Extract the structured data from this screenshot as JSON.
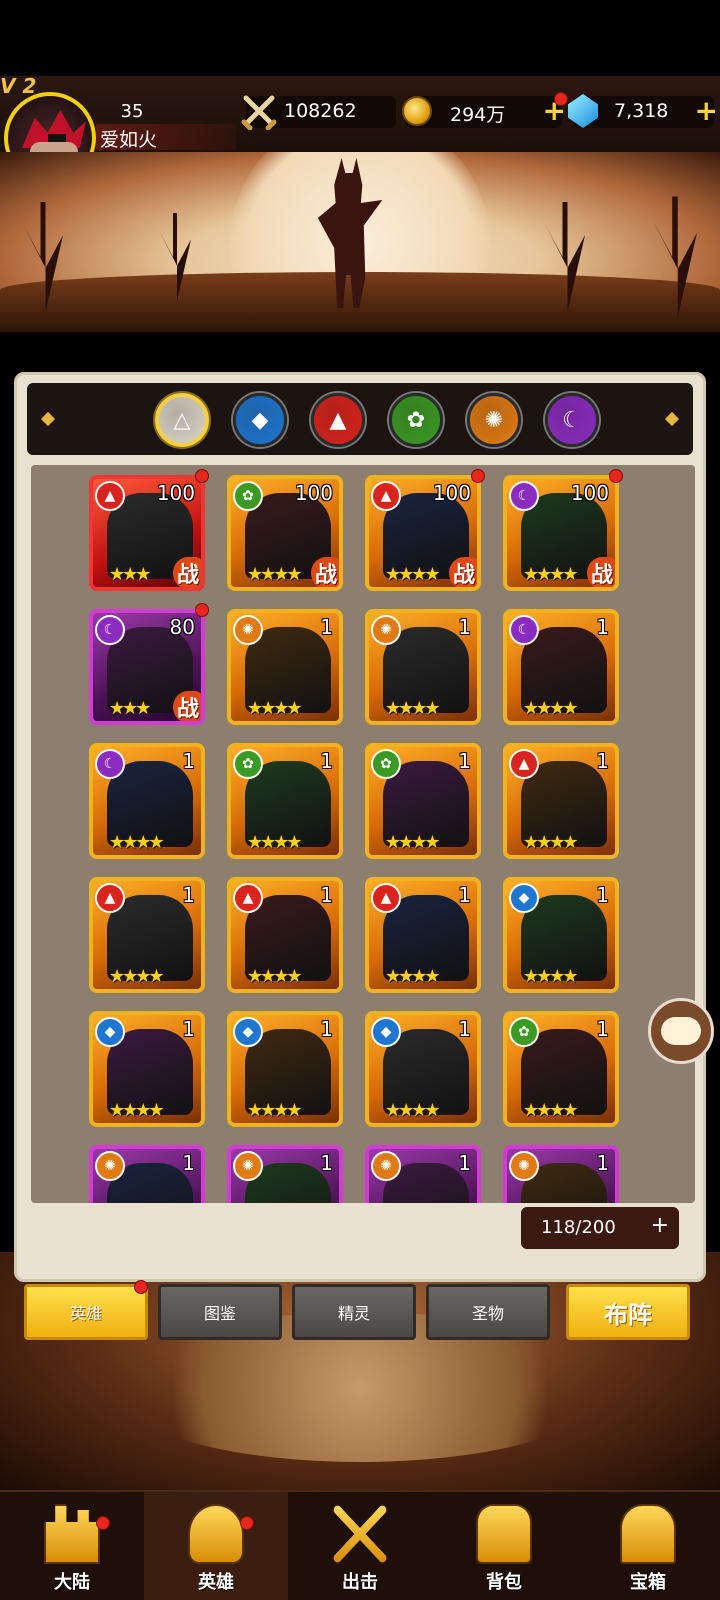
{
  "player": {
    "vip": "V 2",
    "level": "35",
    "name": "爱如火"
  },
  "resources": {
    "power": "108262",
    "gold": "294万",
    "gems": "7,318"
  },
  "colors": {
    "accent": "#f2b21b",
    "panel": "#e8e1cf",
    "tab_active": "#ffd53a"
  },
  "element_filters": [
    {
      "name": "all",
      "icon": "triangle-icon",
      "color": "#d9d4c6",
      "selected": true
    },
    {
      "name": "water",
      "icon": "water-drop-icon",
      "color": "#1f76d0"
    },
    {
      "name": "fire",
      "icon": "flame-icon",
      "color": "#d8241c"
    },
    {
      "name": "wind",
      "icon": "leaf-icon",
      "color": "#3a9a24"
    },
    {
      "name": "sun",
      "icon": "spiral-icon",
      "color": "#e07a12"
    },
    {
      "name": "moon",
      "icon": "moon-icon",
      "color": "#8a2cc0"
    }
  ],
  "heroes": [
    {
      "element": "fire",
      "level": "100",
      "stars": 3,
      "battle": "战",
      "frame": "red",
      "dot": true
    },
    {
      "element": "wind",
      "level": "100",
      "stars": 4,
      "battle": "战",
      "frame": "gold",
      "dot": false
    },
    {
      "element": "fire",
      "level": "100",
      "stars": 4,
      "battle": "战",
      "frame": "gold",
      "dot": true
    },
    {
      "element": "moon",
      "level": "100",
      "stars": 4,
      "battle": "战",
      "frame": "gold",
      "dot": true
    },
    {
      "element": "moon",
      "level": "80",
      "stars": 3,
      "battle": "战",
      "frame": "purple",
      "dot": true
    },
    {
      "element": "sun",
      "level": "1",
      "stars": 4,
      "battle": "",
      "frame": "gold",
      "dot": false
    },
    {
      "element": "sun",
      "level": "1",
      "stars": 4,
      "battle": "",
      "frame": "gold",
      "dot": false
    },
    {
      "element": "moon",
      "level": "1",
      "stars": 4,
      "battle": "",
      "frame": "gold",
      "dot": false
    },
    {
      "element": "moon",
      "level": "1",
      "stars": 4,
      "battle": "",
      "frame": "gold",
      "dot": false
    },
    {
      "element": "wind",
      "level": "1",
      "stars": 4,
      "battle": "",
      "frame": "gold",
      "dot": false
    },
    {
      "element": "wind",
      "level": "1",
      "stars": 4,
      "battle": "",
      "frame": "gold",
      "dot": false
    },
    {
      "element": "fire",
      "level": "1",
      "stars": 4,
      "battle": "",
      "frame": "gold",
      "dot": false
    },
    {
      "element": "fire",
      "level": "1",
      "stars": 4,
      "battle": "",
      "frame": "gold",
      "dot": false
    },
    {
      "element": "fire",
      "level": "1",
      "stars": 4,
      "battle": "",
      "frame": "gold",
      "dot": false
    },
    {
      "element": "fire",
      "level": "1",
      "stars": 4,
      "battle": "",
      "frame": "gold",
      "dot": false
    },
    {
      "element": "water",
      "level": "1",
      "stars": 4,
      "battle": "",
      "frame": "gold",
      "dot": false
    },
    {
      "element": "water",
      "level": "1",
      "stars": 4,
      "battle": "",
      "frame": "gold",
      "dot": false
    },
    {
      "element": "water",
      "level": "1",
      "stars": 4,
      "battle": "",
      "frame": "gold",
      "dot": false
    },
    {
      "element": "water",
      "level": "1",
      "stars": 4,
      "battle": "",
      "frame": "gold",
      "dot": false
    },
    {
      "element": "wind",
      "level": "1",
      "stars": 4,
      "battle": "",
      "frame": "gold",
      "dot": false
    },
    {
      "element": "sun",
      "level": "1",
      "stars": 0,
      "battle": "",
      "frame": "purple",
      "dot": false
    },
    {
      "element": "sun",
      "level": "1",
      "stars": 0,
      "battle": "",
      "frame": "purple",
      "dot": false
    },
    {
      "element": "sun",
      "level": "1",
      "stars": 0,
      "battle": "",
      "frame": "purple",
      "dot": false
    },
    {
      "element": "sun",
      "level": "1",
      "stars": 0,
      "battle": "",
      "frame": "purple",
      "dot": false
    }
  ],
  "capacity": {
    "text": "118/200",
    "plus": "+"
  },
  "tabs": {
    "heroes": "英雄",
    "codex": "图鉴",
    "spirits": "精灵",
    "relics": "圣物",
    "formation": "布阵"
  },
  "nav": {
    "continent": "大陆",
    "heroes": "英雄",
    "battle": "出击",
    "bag": "背包",
    "chest": "宝箱"
  }
}
